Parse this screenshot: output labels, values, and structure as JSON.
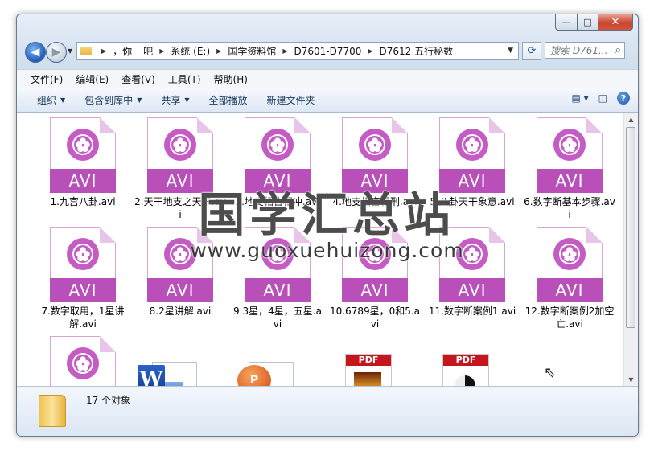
{
  "window": {
    "caption": {
      "min": "—",
      "max": "□",
      "close": "✕"
    }
  },
  "address": {
    "crumbs": [
      "，你",
      "吧",
      "系统 (E:)",
      "国学资料馆",
      "D7601-D7700",
      "D7612 五行秘数"
    ],
    "search_placeholder": "搜索 D761..."
  },
  "menu": [
    "文件(F)",
    "编辑(E)",
    "查看(V)",
    "工具(T)",
    "帮助(H)"
  ],
  "toolbar": {
    "organize": "组织",
    "include": "包含到库中",
    "share": "共享",
    "play_all": "全部播放",
    "new_folder": "新建文件夹"
  },
  "files": [
    {
      "name": "1.九宫八卦.avi",
      "type": "AVI"
    },
    {
      "name": "2.天干地支之天干.avi",
      "type": "AVI"
    },
    {
      "name": "3.地支相合相冲.avi",
      "type": "AVI"
    },
    {
      "name": "4.地支相害相刑.avi",
      "type": "AVI"
    },
    {
      "name": "5.八卦天干象意.avi",
      "type": "AVI"
    },
    {
      "name": "6.数字断基本步骤.avi",
      "type": "AVI"
    },
    {
      "name": "7.数字取用，1星讲解.avi",
      "type": "AVI"
    },
    {
      "name": "8.2星讲解.avi",
      "type": "AVI"
    },
    {
      "name": "9.3星，4星，五星.avi",
      "type": "AVI"
    },
    {
      "name": "10.6789星，0和5.avi",
      "type": "AVI"
    },
    {
      "name": "11.数字断案例1.avi",
      "type": "AVI"
    },
    {
      "name": "12.数字断案例2加空亡.avi",
      "type": "AVI"
    }
  ],
  "bottom_icons": {
    "pdf_label": "PDF",
    "word_letter": "W",
    "ppt_letter": "P"
  },
  "watermark": {
    "title": "国学汇总站",
    "url": "www.guoxuehuizong.com"
  },
  "status": {
    "count": "17 个对象"
  }
}
